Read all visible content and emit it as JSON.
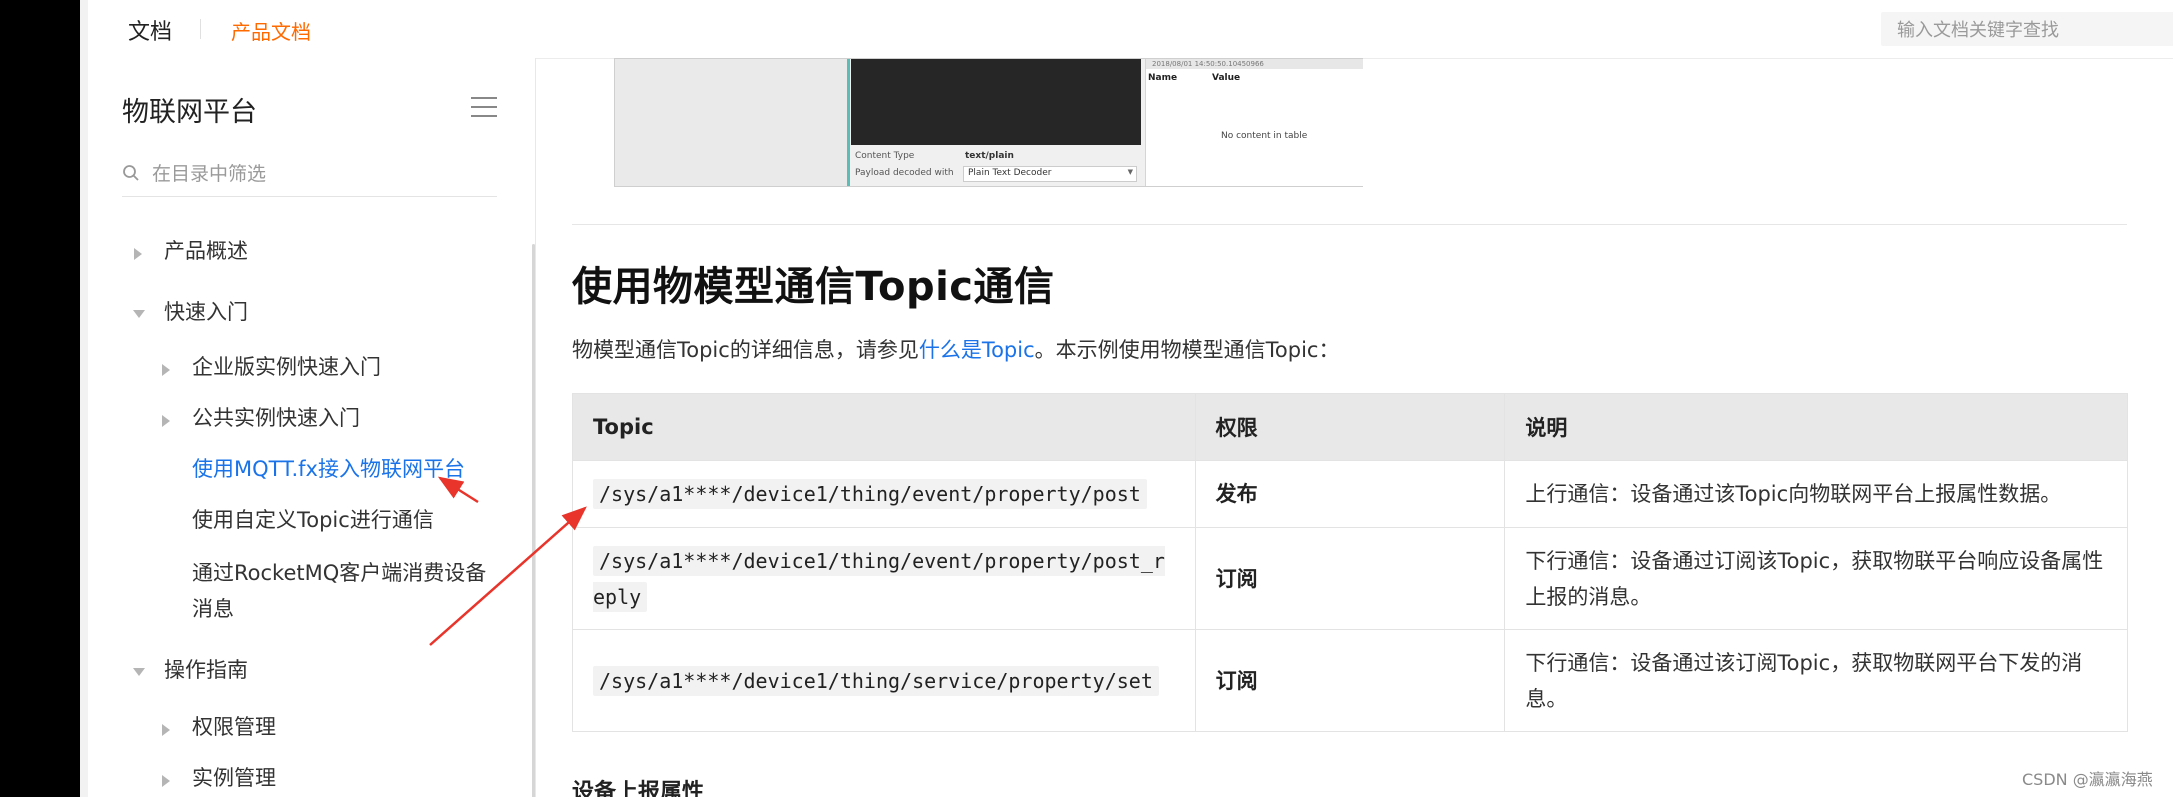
{
  "topbar": {
    "doc_label": "文档",
    "product_label": "产品文档",
    "search_placeholder": "输入文档关键字查找"
  },
  "sidebar": {
    "title": "物联网平台",
    "filter_placeholder": "在目录中筛选",
    "items": [
      {
        "label": "产品概述",
        "state": "collapsed"
      },
      {
        "label": "快速入门",
        "state": "expanded"
      },
      {
        "label": "企业版实例快速入门",
        "state": "collapsed"
      },
      {
        "label": "公共实例快速入门",
        "state": "collapsed"
      },
      {
        "label": "使用MQTT.fx接入物联网平台",
        "state": "active"
      },
      {
        "label": "使用自定义Topic进行通信",
        "state": "leaf"
      },
      {
        "label": "通过RocketMQ客户端消费设备",
        "label2": "消息",
        "state": "leaf"
      },
      {
        "label": "操作指南",
        "state": "expanded"
      },
      {
        "label": "权限管理",
        "state": "collapsed"
      },
      {
        "label": "实例管理",
        "state": "collapsed"
      }
    ]
  },
  "embedded_screenshot": {
    "content_type_label": "Content Type",
    "content_type_value": "text/plain",
    "payload_label": "Payload decoded with",
    "payload_value": "Plain Text Decoder",
    "timestamp": "2018/08/01 14:50:50.10450966",
    "col_name": "Name",
    "col_value": "Value",
    "empty_text": "No content in table"
  },
  "article": {
    "heading": "使用物模型通信Topic通信",
    "desc_before": "物模型通信Topic的详细信息，请参见",
    "desc_link": "什么是Topic",
    "desc_after": "。本示例使用物模型通信Topic：",
    "table": {
      "headers": [
        "Topic",
        "权限",
        "说明"
      ],
      "rows": [
        {
          "topic": "/sys/a1****/device1/thing/event/property/post",
          "perm": "发布",
          "desc": "上行通信：设备通过该Topic向物联网平台上报属性数据。"
        },
        {
          "topic": "/sys/a1****/device1/thing/event/property/post_reply",
          "perm": "订阅",
          "desc": "下行通信：设备通过订阅该Topic，获取物联平台响应设备属性上报的消息。"
        },
        {
          "topic": "/sys/a1****/device1/thing/service/property/set",
          "perm": "订阅",
          "desc": "下行通信：设备通过该订阅Topic，获取物联网平台下发的消息。"
        }
      ]
    },
    "subheading": "设备上报属性"
  },
  "watermark": "CSDN @瀛瀛海燕",
  "colors": {
    "accent_orange": "#ff6a00",
    "link_blue": "#1a73e8",
    "annotation_red": "#e8342a"
  }
}
